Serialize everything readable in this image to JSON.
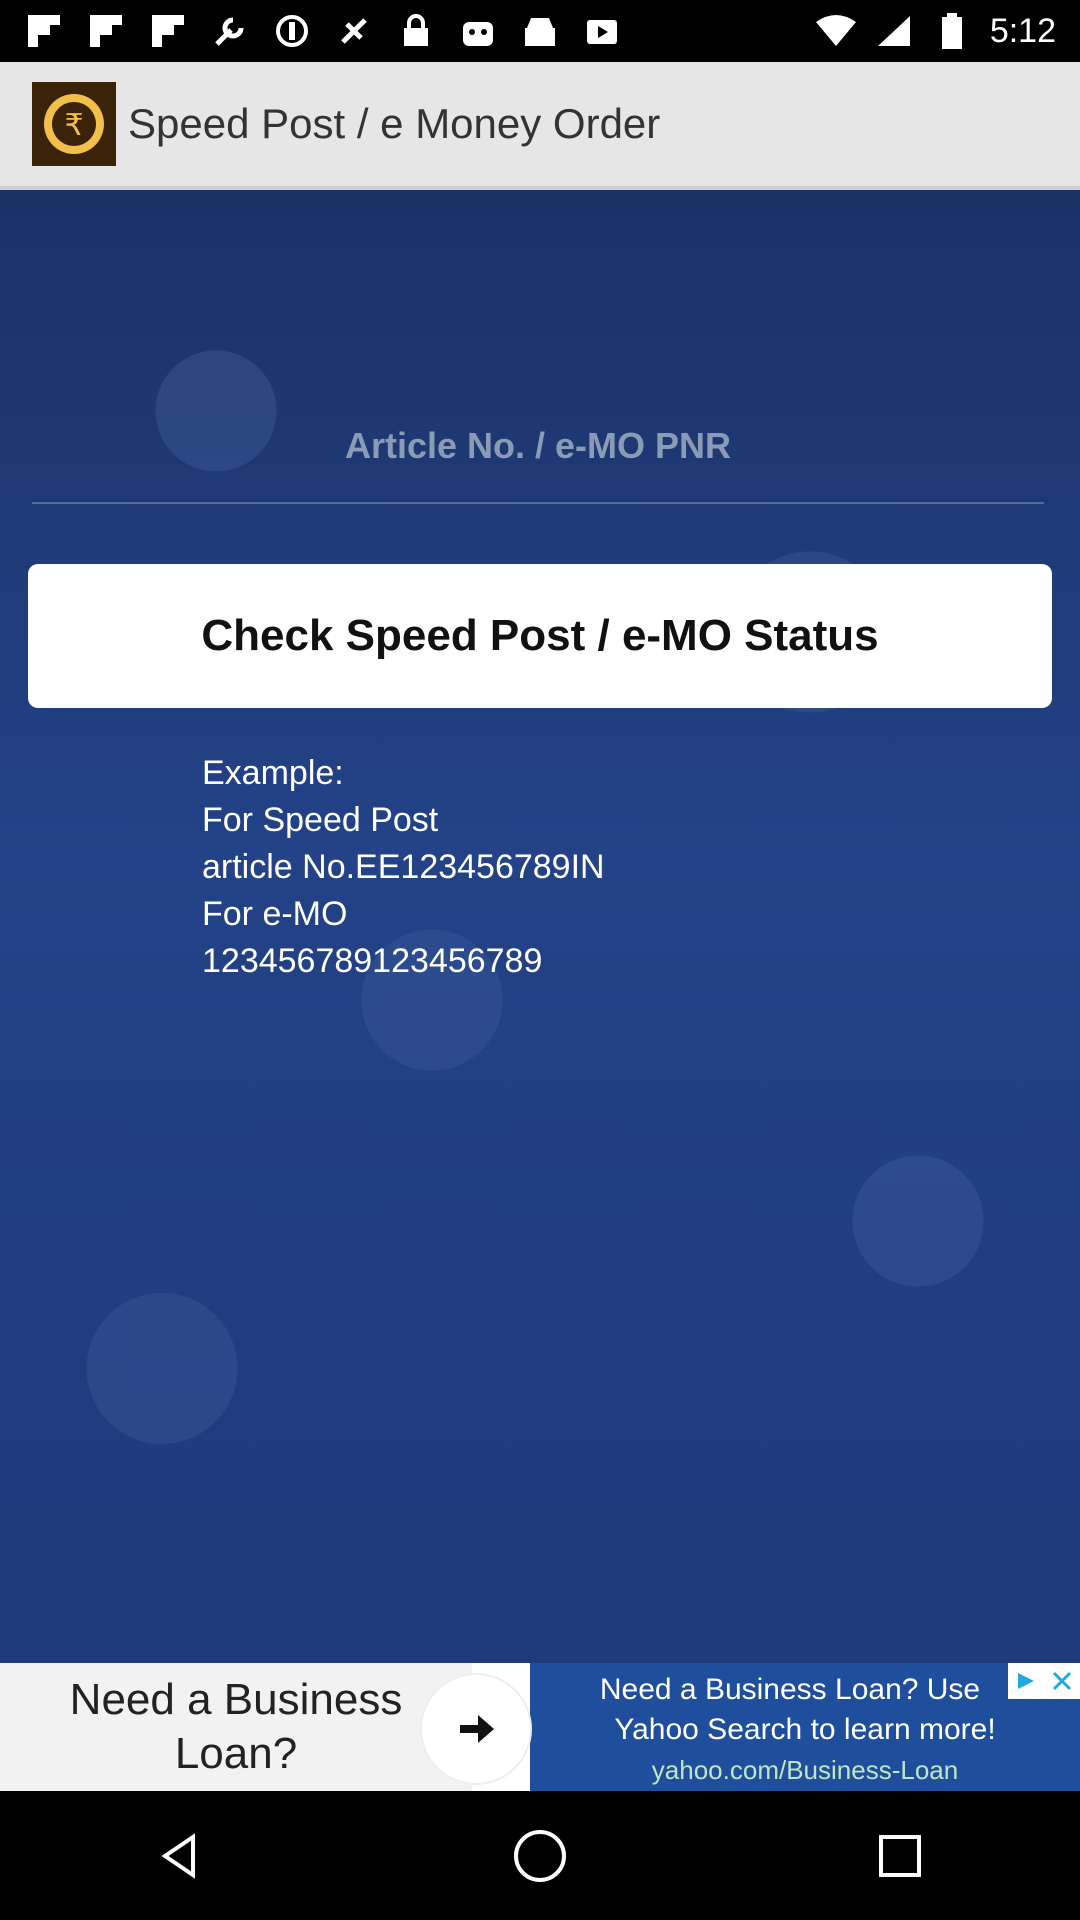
{
  "status_bar": {
    "time": "5:12",
    "icons_left": [
      "flipboard-icon",
      "flipboard-icon",
      "flipboard-icon",
      "wrench-icon",
      "pinwheel-icon",
      "fake-gps-icon",
      "lock-icon",
      "bag-icon",
      "inbox-icon",
      "play-store-icon"
    ],
    "icons_right": [
      "wifi-icon",
      "signal-icon",
      "battery-icon"
    ]
  },
  "app_bar": {
    "title": "Speed Post / e Money Order",
    "logo_icon": "rupee-icon"
  },
  "form": {
    "pnr_placeholder": "Article No. / e-MO PNR",
    "check_button": "Check Speed Post / e-MO Status"
  },
  "example": {
    "line1": "Example:",
    "line2": "For Speed Post",
    "line3": "article No.EE123456789IN",
    "line4": "For e-MO",
    "line5": "123456789123456789"
  },
  "ad": {
    "left_text_1": "Need a Business",
    "left_text_2": "Loan?",
    "right_line1": "Need a Business Loan? Use",
    "right_line2": "Yahoo Search to learn more!",
    "url": "yahoo.com/Business-Loan",
    "colors": {
      "right_bg": "#1f4e9c"
    }
  },
  "nav": {
    "back": "back-icon",
    "home": "home-icon",
    "recents": "recents-icon"
  }
}
